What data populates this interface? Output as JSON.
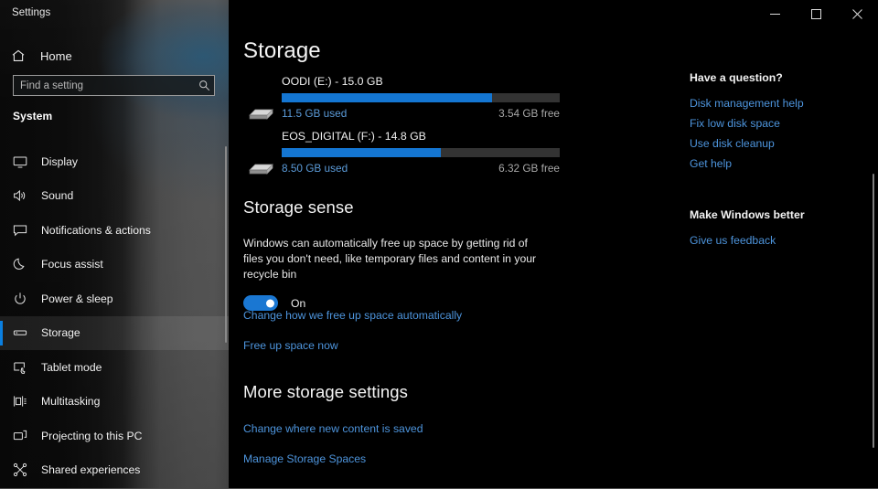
{
  "window": {
    "caption": "Settings",
    "controls": [
      {
        "name": "minimize",
        "label": "Minimize"
      },
      {
        "name": "maximize",
        "label": "Maximize"
      },
      {
        "name": "close",
        "label": "Close"
      }
    ]
  },
  "accent": {
    "link_blue": "#4d94dc",
    "bar_blue": "#1476d2",
    "toggle_blue": "#1a77d2",
    "selection_blue": "#0a7fe0"
  },
  "sidebar": {
    "home_label": "Home",
    "home_icon": "home-icon",
    "search": {
      "placeholder": "Find a setting",
      "value": "",
      "icon": "search-icon"
    },
    "section_header": "System",
    "items": [
      {
        "label": "Display",
        "icon": "monitor-icon",
        "selected": false
      },
      {
        "label": "Sound",
        "icon": "speaker-icon",
        "selected": false
      },
      {
        "label": "Notifications & actions",
        "icon": "chat-bubble-icon",
        "selected": false
      },
      {
        "label": "Focus assist",
        "icon": "moon-icon",
        "selected": false
      },
      {
        "label": "Power & sleep",
        "icon": "power-icon",
        "selected": false
      },
      {
        "label": "Storage",
        "icon": "drive-icon",
        "selected": true
      },
      {
        "label": "Tablet mode",
        "icon": "tablet-icon",
        "selected": false
      },
      {
        "label": "Multitasking",
        "icon": "multitasking-icon",
        "selected": false
      },
      {
        "label": "Projecting to this PC",
        "icon": "projecting-icon",
        "selected": false
      },
      {
        "label": "Shared experiences",
        "icon": "share-icon",
        "selected": false
      }
    ]
  },
  "main": {
    "title": "Storage",
    "drives": [
      {
        "name": "OODI (E:) - 15.0 GB",
        "used_label": "11.5 GB used",
        "free_label": "3.54 GB free",
        "percent_used": 75.5,
        "icon": "disk-drive-icon"
      },
      {
        "name": "EOS_DIGITAL (F:) - 14.8 GB",
        "used_label": "8.50 GB used",
        "free_label": "6.32 GB free",
        "percent_used": 57.4,
        "icon": "disk-drive-icon"
      }
    ],
    "storage_sense": {
      "heading": "Storage sense",
      "description": "Windows can automatically free up space by getting rid of files you don't need, like temporary files and content in your recycle bin",
      "toggle_state": "On",
      "toggle_on": true,
      "links": [
        "Change how we free up space automatically",
        "Free up space now"
      ]
    },
    "more_storage": {
      "heading": "More storage settings",
      "links": [
        "Change where new content is saved",
        "Manage Storage Spaces"
      ]
    }
  },
  "right_column": {
    "blocks": [
      {
        "heading": "Have a question?",
        "links": [
          "Disk management help",
          "Fix low disk space",
          "Use disk cleanup",
          "Get help"
        ]
      },
      {
        "heading": "Make Windows better",
        "links": [
          "Give us feedback"
        ]
      }
    ]
  }
}
